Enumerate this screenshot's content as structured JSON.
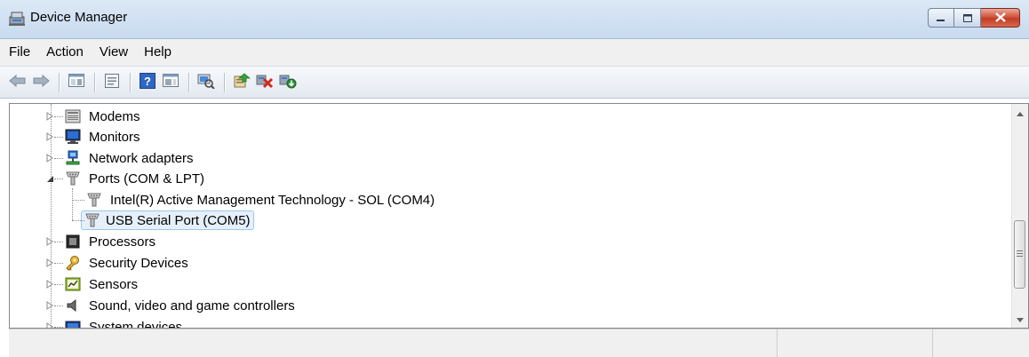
{
  "window": {
    "title": "Device Manager",
    "icon": "device-manager-icon"
  },
  "caption_buttons": [
    "minimize-icon",
    "maximize-icon",
    "close-icon"
  ],
  "menubar": {
    "items": [
      "File",
      "Action",
      "View",
      "Help"
    ]
  },
  "toolbar": {
    "buttons": [
      "back-icon",
      "forward-icon",
      "show-hide-console-tree-icon",
      "properties-icon",
      "help-icon",
      "show-hide-action-pane-icon",
      "scan-hardware-icon",
      "update-driver-icon",
      "uninstall-icon",
      "enable-device-icon"
    ]
  },
  "tree": {
    "items": [
      {
        "label": "Modems",
        "icon": "modem-icon",
        "expanded": false,
        "level": 0
      },
      {
        "label": "Monitors",
        "icon": "monitor-icon",
        "expanded": false,
        "level": 0
      },
      {
        "label": "Network adapters",
        "icon": "network-adapter-icon",
        "expanded": false,
        "level": 0
      },
      {
        "label": "Ports (COM & LPT)",
        "icon": "port-icon",
        "expanded": true,
        "level": 0
      },
      {
        "label": "Intel(R) Active Management Technology - SOL (COM4)",
        "icon": "port-icon",
        "level": 1
      },
      {
        "label": "USB Serial Port (COM5)",
        "icon": "port-icon",
        "level": 1,
        "selected": true
      },
      {
        "label": "Processors",
        "icon": "processor-icon",
        "expanded": false,
        "level": 0
      },
      {
        "label": "Security Devices",
        "icon": "security-device-icon",
        "expanded": false,
        "level": 0
      },
      {
        "label": "Sensors",
        "icon": "sensor-icon",
        "expanded": false,
        "level": 0
      },
      {
        "label": "Sound, video and game controllers",
        "icon": "sound-icon",
        "expanded": false,
        "level": 0
      },
      {
        "label": "System devices",
        "icon": "system-devices-icon",
        "expanded": false,
        "level": 0
      }
    ]
  },
  "colors": {
    "selection_fill": "#e6f0fa",
    "selection_border": "#9ec5ef",
    "titlebar": "#d3e2f3",
    "close_button": "#c23c25"
  }
}
